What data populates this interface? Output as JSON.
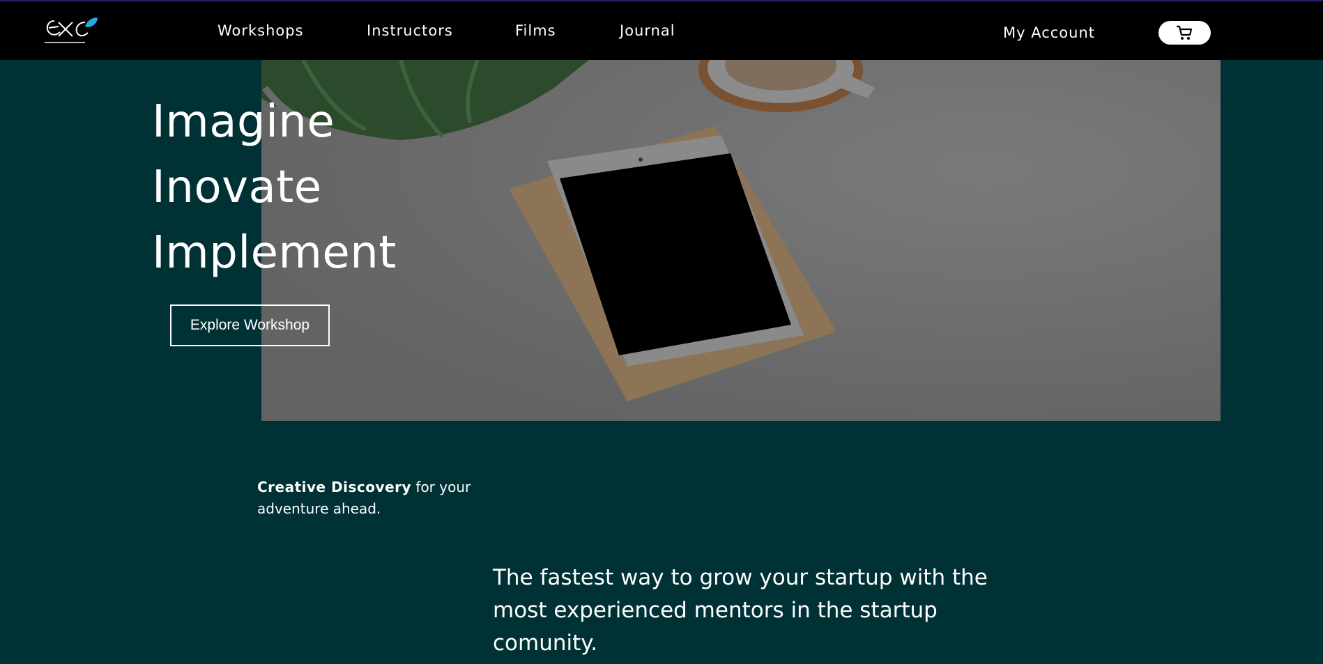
{
  "header": {
    "logo_alt": "ExC entrepreneurship cell",
    "nav": [
      {
        "label": "Workshops"
      },
      {
        "label": "Instructors"
      },
      {
        "label": "Films"
      },
      {
        "label": "Journal"
      }
    ],
    "account_label": "My Account",
    "cart_icon": "cart-icon"
  },
  "hero": {
    "lines": [
      "Imagine",
      "Inovate",
      "Implement"
    ],
    "cta_label": "Explore Workshop"
  },
  "intro": {
    "bold": "Creative Discovery",
    "rest": " for your adventure ahead."
  },
  "tagline": "The fastest way to grow your startup with the most experienced mentors in the startup comunity.",
  "colors": {
    "header_bg": "#000000",
    "page_bg": "#003135",
    "photo_overlay": "#6b6b6b",
    "accent_blue": "#2aa7e0"
  }
}
